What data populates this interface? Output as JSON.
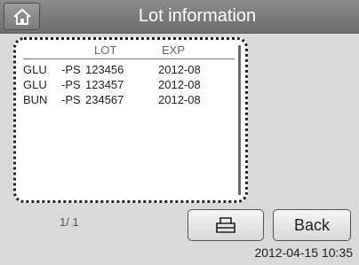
{
  "header": {
    "title": "Lot information"
  },
  "table": {
    "columns": [
      "LOT",
      "EXP"
    ],
    "rows": [
      {
        "item": "GLU",
        "type": "-PS",
        "lot": "123456",
        "exp": "2012-08"
      },
      {
        "item": "GLU",
        "type": "-PS",
        "lot": "123457",
        "exp": "2012-08"
      },
      {
        "item": "BUN",
        "type": "-PS",
        "lot": "234567",
        "exp": "2012-08"
      }
    ]
  },
  "pager": {
    "current": "1",
    "total": "1",
    "text": "1/ 1"
  },
  "buttons": {
    "back_label": "Back",
    "print_icon": "printer-icon",
    "home_icon": "home-icon"
  },
  "status": {
    "datetime": "2012-04-15 10:35"
  }
}
